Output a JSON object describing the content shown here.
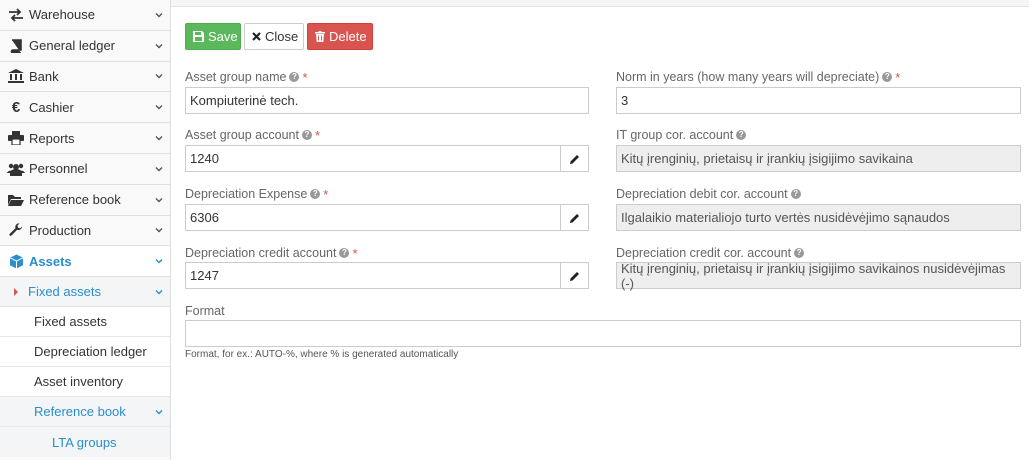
{
  "sidebar": {
    "items": [
      {
        "label": "Warehouse",
        "icon": "exchange-icon"
      },
      {
        "label": "General ledger",
        "icon": "book-icon"
      },
      {
        "label": "Bank",
        "icon": "bank-icon"
      },
      {
        "label": "Cashier",
        "icon": "euro-icon"
      },
      {
        "label": "Reports",
        "icon": "print-icon"
      },
      {
        "label": "Personnel",
        "icon": "users-icon"
      },
      {
        "label": "Reference book",
        "icon": "folder-open-icon"
      },
      {
        "label": "Production",
        "icon": "wrench-icon"
      },
      {
        "label": "Assets",
        "icon": "cube-icon"
      }
    ],
    "fixed_assets_header": "Fixed assets",
    "sub_items": [
      "Fixed assets",
      "Depreciation ledger",
      "Asset inventory"
    ],
    "reference_book": "Reference book",
    "lta_groups": "LTA groups"
  },
  "toolbar": {
    "save_label": "Save",
    "close_label": "Close",
    "delete_label": "Delete"
  },
  "form": {
    "asset_group_name": {
      "label": "Asset group name",
      "value": "Kompiuterinė tech."
    },
    "norm_years": {
      "label": "Norm in years (how many years will depreciate)",
      "value": "3"
    },
    "asset_group_account": {
      "label": "Asset group account",
      "value": "1240"
    },
    "it_group_cor": {
      "label": "IT group cor. account",
      "value": "Kitų įrenginių, prietaisų ir įrankių įsigijimo savikaina"
    },
    "depreciation_expense": {
      "label": "Depreciation Expense",
      "value": "6306"
    },
    "depreciation_debit_cor": {
      "label": "Depreciation debit cor. account",
      "value": "Ilgalaikio materialiojo turto vertės nusidėvėjimo sąnaudos"
    },
    "depreciation_credit": {
      "label": "Depreciation credit account",
      "value": "1247"
    },
    "depreciation_credit_cor": {
      "label": "Depreciation credit cor. account",
      "value": "Kitų įrenginių, prietaisų ir įrankių įsigijimo savikainos nusidėvėjimas (-)"
    },
    "format": {
      "label": "Format",
      "value": "",
      "hint": "Format, for ex.: AUTO-%, where % is generated automatically"
    }
  },
  "colors": {
    "accent": "#2a8ecb",
    "save": "#5cb85c",
    "delete": "#d9534f",
    "required": "#d9534f"
  }
}
